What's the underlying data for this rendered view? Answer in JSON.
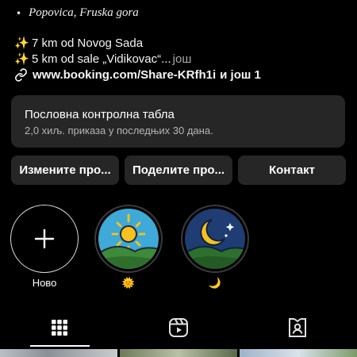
{
  "bio": {
    "location_line": "Popovica, Fruska gora",
    "line1": "7 km od Novog Sada",
    "line2": "5 km od sale „Vidikovac“...",
    "line2_more": "још",
    "spark_glyph": "✨",
    "link": "www.booking.com/Share-KRfh1i",
    "link_more": "и још 1"
  },
  "dashboard": {
    "title": "Пословна контролна табла",
    "subtitle": "2,0 хиљ. приказа у последњих 30 дана."
  },
  "buttons": {
    "edit": "Измените про...",
    "share": "Поделите про...",
    "contact": "Контакт"
  },
  "highlights": [
    {
      "label": "Ново",
      "icon": "plus-icon"
    },
    {
      "label": "🌞",
      "icon": "sun-icon"
    },
    {
      "label": "🌙",
      "icon": "moon-icon"
    }
  ],
  "tabs": [
    {
      "icon": "grid-icon",
      "active": true
    },
    {
      "icon": "reels-icon",
      "active": false
    },
    {
      "icon": "tagged-icon",
      "active": false
    }
  ],
  "colors": {
    "background": "#000000",
    "card": "#262626",
    "muted_text": "#a8a8a8",
    "sky_day": "#3fa9d8",
    "sky_night": "#1f3d72",
    "hill_green": "#3e8a3a",
    "sun_yellow": "#f7c11e"
  }
}
